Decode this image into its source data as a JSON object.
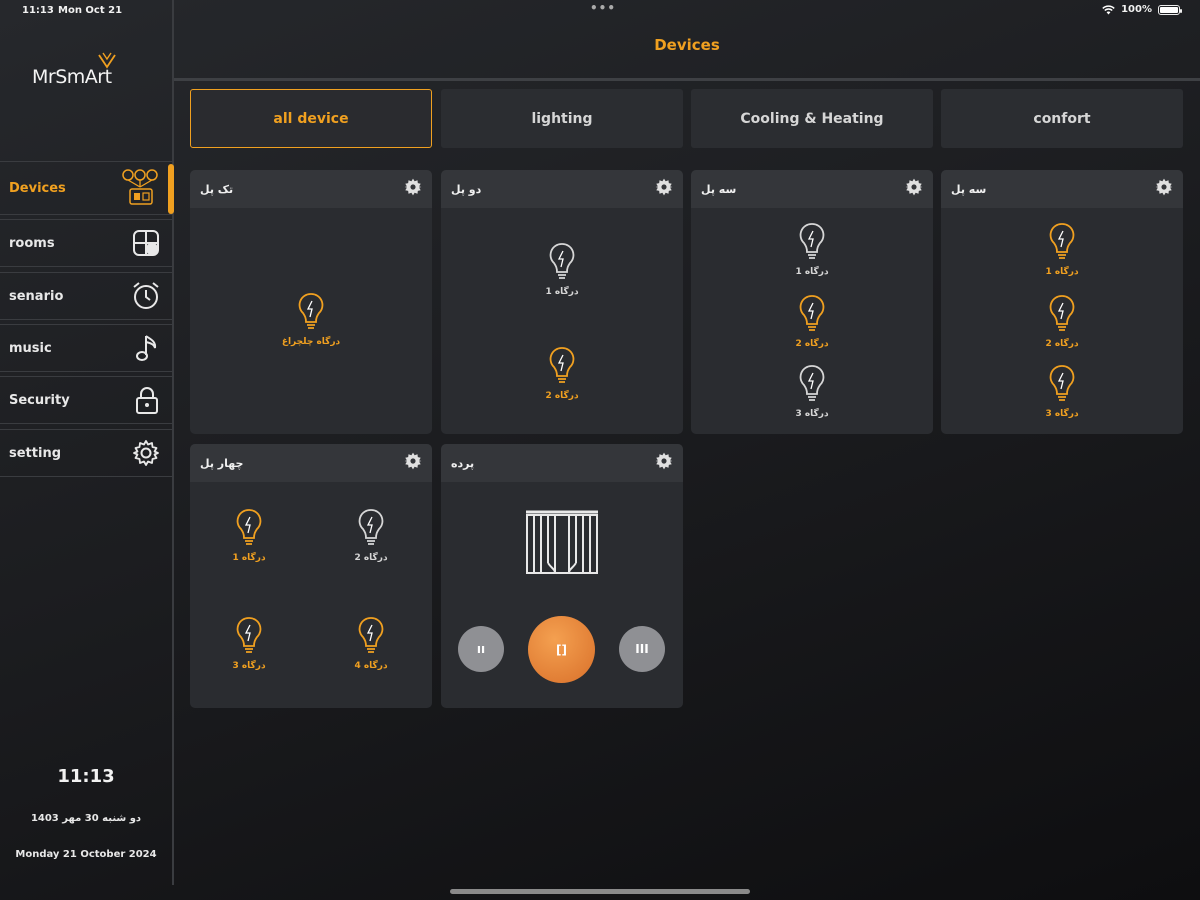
{
  "status_bar": {
    "time": "11:13",
    "date": "Mon Oct 21",
    "battery": "100%"
  },
  "logo": {
    "text": "MrSmArt"
  },
  "sidebar": {
    "items": [
      {
        "label": "Devices",
        "icon": "devices-icon",
        "active": true
      },
      {
        "label": "rooms",
        "icon": "rooms-icon"
      },
      {
        "label": "senario",
        "icon": "alarm-clock-icon"
      },
      {
        "label": "music",
        "icon": "music-note-icon"
      },
      {
        "label": "Security",
        "icon": "lock-icon"
      },
      {
        "label": "setting",
        "icon": "gear-icon"
      }
    ],
    "clock": "11:13",
    "date_fa": "دو شنبه 30 مهر 1403",
    "date_en": "Monday 21 October 2024"
  },
  "header": {
    "title": "Devices"
  },
  "tabs": [
    {
      "label": "all device",
      "active": true
    },
    {
      "label": "lighting"
    },
    {
      "label": "Cooling & Heating"
    },
    {
      "label": "confort"
    }
  ],
  "cards": [
    {
      "title": "تک پل",
      "bulbs": [
        {
          "label": "درگاه چلچراغ",
          "on": true
        }
      ]
    },
    {
      "title": "دو پل",
      "bulbs": [
        {
          "label": "درگاه 1",
          "on": false
        },
        {
          "label": "درگاه 2",
          "on": true
        }
      ]
    },
    {
      "title": "سه پل",
      "bulbs": [
        {
          "label": "درگاه 1",
          "on": false
        },
        {
          "label": "درگاه 2",
          "on": true
        },
        {
          "label": "درگاه 3",
          "on": false
        }
      ]
    },
    {
      "title": "سه پل",
      "bulbs": [
        {
          "label": "درگاه 1",
          "on": true
        },
        {
          "label": "درگاه 2",
          "on": true
        },
        {
          "label": "درگاه 3",
          "on": true
        }
      ]
    },
    {
      "title": "چهار پل",
      "bulbs": [
        {
          "label": "درگاه 1",
          "on": true
        },
        {
          "label": "درگاه 2",
          "on": false
        },
        {
          "label": "درگاه 3",
          "on": true
        },
        {
          "label": "درگاه 4",
          "on": true
        }
      ]
    },
    {
      "title": "پرده",
      "curtain": {
        "buttons": [
          {
            "label": "ıı",
            "active": false
          },
          {
            "label": "[]",
            "active": true
          },
          {
            "label": "III",
            "active": false
          }
        ]
      }
    }
  ],
  "colors": {
    "accent": "#f0a020",
    "card": "#2a2c30",
    "card_header": "#34363a",
    "off_button": "#8f9094"
  }
}
